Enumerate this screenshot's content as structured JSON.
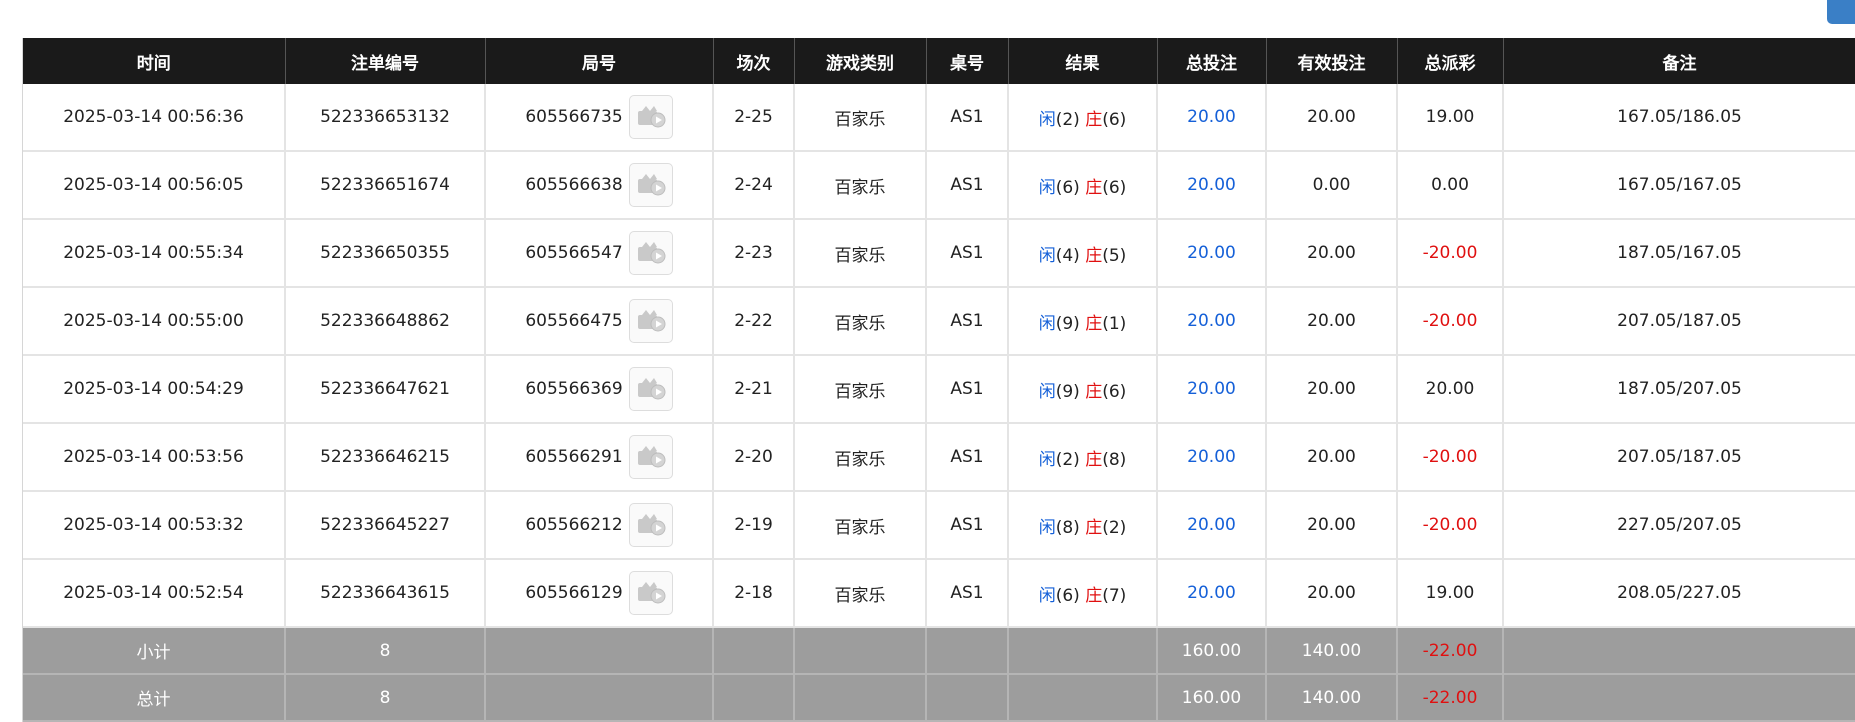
{
  "colors": {
    "header_bg": "#1a1a1a",
    "footer_bg": "#9d9d9d",
    "blue": "#1560d8",
    "red": "#e01010"
  },
  "columns": [
    "时间",
    "注单编号",
    "局号",
    "场次",
    "游戏类别",
    "桌号",
    "结果",
    "总投注",
    "有效投注",
    "总派彩",
    "备注"
  ],
  "rows": [
    {
      "time": "2025-03-14 00:56:36",
      "bet_id": "522336653132",
      "round": "605566735",
      "shoe": "2-25",
      "game": "百家乐",
      "table": "AS1",
      "player_label": "闲",
      "player_score": "(2)",
      "banker_label": "庄",
      "banker_score": "(6)",
      "total_bet": "20.00",
      "valid_bet": "20.00",
      "payout": "19.00",
      "payout_neg": false,
      "note": "167.05/186.05"
    },
    {
      "time": "2025-03-14 00:56:05",
      "bet_id": "522336651674",
      "round": "605566638",
      "shoe": "2-24",
      "game": "百家乐",
      "table": "AS1",
      "player_label": "闲",
      "player_score": "(6)",
      "banker_label": "庄",
      "banker_score": "(6)",
      "total_bet": "20.00",
      "valid_bet": "0.00",
      "payout": "0.00",
      "payout_neg": false,
      "note": "167.05/167.05"
    },
    {
      "time": "2025-03-14 00:55:34",
      "bet_id": "522336650355",
      "round": "605566547",
      "shoe": "2-23",
      "game": "百家乐",
      "table": "AS1",
      "player_label": "闲",
      "player_score": "(4)",
      "banker_label": "庄",
      "banker_score": "(5)",
      "total_bet": "20.00",
      "valid_bet": "20.00",
      "payout": "-20.00",
      "payout_neg": true,
      "note": "187.05/167.05"
    },
    {
      "time": "2025-03-14 00:55:00",
      "bet_id": "522336648862",
      "round": "605566475",
      "shoe": "2-22",
      "game": "百家乐",
      "table": "AS1",
      "player_label": "闲",
      "player_score": "(9)",
      "banker_label": "庄",
      "banker_score": "(1)",
      "total_bet": "20.00",
      "valid_bet": "20.00",
      "payout": "-20.00",
      "payout_neg": true,
      "note": "207.05/187.05"
    },
    {
      "time": "2025-03-14 00:54:29",
      "bet_id": "522336647621",
      "round": "605566369",
      "shoe": "2-21",
      "game": "百家乐",
      "table": "AS1",
      "player_label": "闲",
      "player_score": "(9)",
      "banker_label": "庄",
      "banker_score": "(6)",
      "total_bet": "20.00",
      "valid_bet": "20.00",
      "payout": "20.00",
      "payout_neg": false,
      "note": "187.05/207.05"
    },
    {
      "time": "2025-03-14 00:53:56",
      "bet_id": "522336646215",
      "round": "605566291",
      "shoe": "2-20",
      "game": "百家乐",
      "table": "AS1",
      "player_label": "闲",
      "player_score": "(2)",
      "banker_label": "庄",
      "banker_score": "(8)",
      "total_bet": "20.00",
      "valid_bet": "20.00",
      "payout": "-20.00",
      "payout_neg": true,
      "note": "207.05/187.05"
    },
    {
      "time": "2025-03-14 00:53:32",
      "bet_id": "522336645227",
      "round": "605566212",
      "shoe": "2-19",
      "game": "百家乐",
      "table": "AS1",
      "player_label": "闲",
      "player_score": "(8)",
      "banker_label": "庄",
      "banker_score": "(2)",
      "total_bet": "20.00",
      "valid_bet": "20.00",
      "payout": "-20.00",
      "payout_neg": true,
      "note": "227.05/207.05"
    },
    {
      "time": "2025-03-14 00:52:54",
      "bet_id": "522336643615",
      "round": "605566129",
      "shoe": "2-18",
      "game": "百家乐",
      "table": "AS1",
      "player_label": "闲",
      "player_score": "(6)",
      "banker_label": "庄",
      "banker_score": "(7)",
      "total_bet": "20.00",
      "valid_bet": "20.00",
      "payout": "19.00",
      "payout_neg": false,
      "note": "208.05/227.05"
    }
  ],
  "subtotal": {
    "label": "小计",
    "count": "8",
    "total_bet": "160.00",
    "valid_bet": "140.00",
    "payout": "-22.00"
  },
  "total": {
    "label": "总计",
    "count": "8",
    "total_bet": "160.00",
    "valid_bet": "140.00",
    "payout": "-22.00"
  }
}
